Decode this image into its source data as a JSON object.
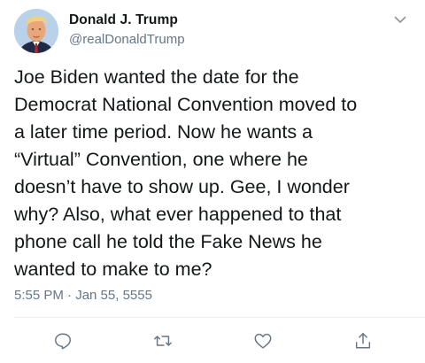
{
  "tweet": {
    "author_name": "Donald J. Trump",
    "author_handle": "@realDonaldTrump",
    "text": "Joe Biden wanted the date for the\nDemocrat National Convention moved to\na later time period. Now he wants a\n“Virtual” Convention, one where he\ndoesn’t have to show up. Gee, I wonder\nwhy? Also, what ever happened to that\nphone call he told the Fake News he\nwanted to make to me?",
    "timestamp": "5:55 PM · Jan 55, 5555"
  },
  "actions": {
    "reply_icon": "reply-icon",
    "retweet_icon": "retweet-icon",
    "like_icon": "heart-icon",
    "share_icon": "share-icon"
  },
  "colors": {
    "text_primary": "#14171a",
    "text_secondary": "#657786",
    "icon": "#657786",
    "divider": "#e6ecf0"
  }
}
